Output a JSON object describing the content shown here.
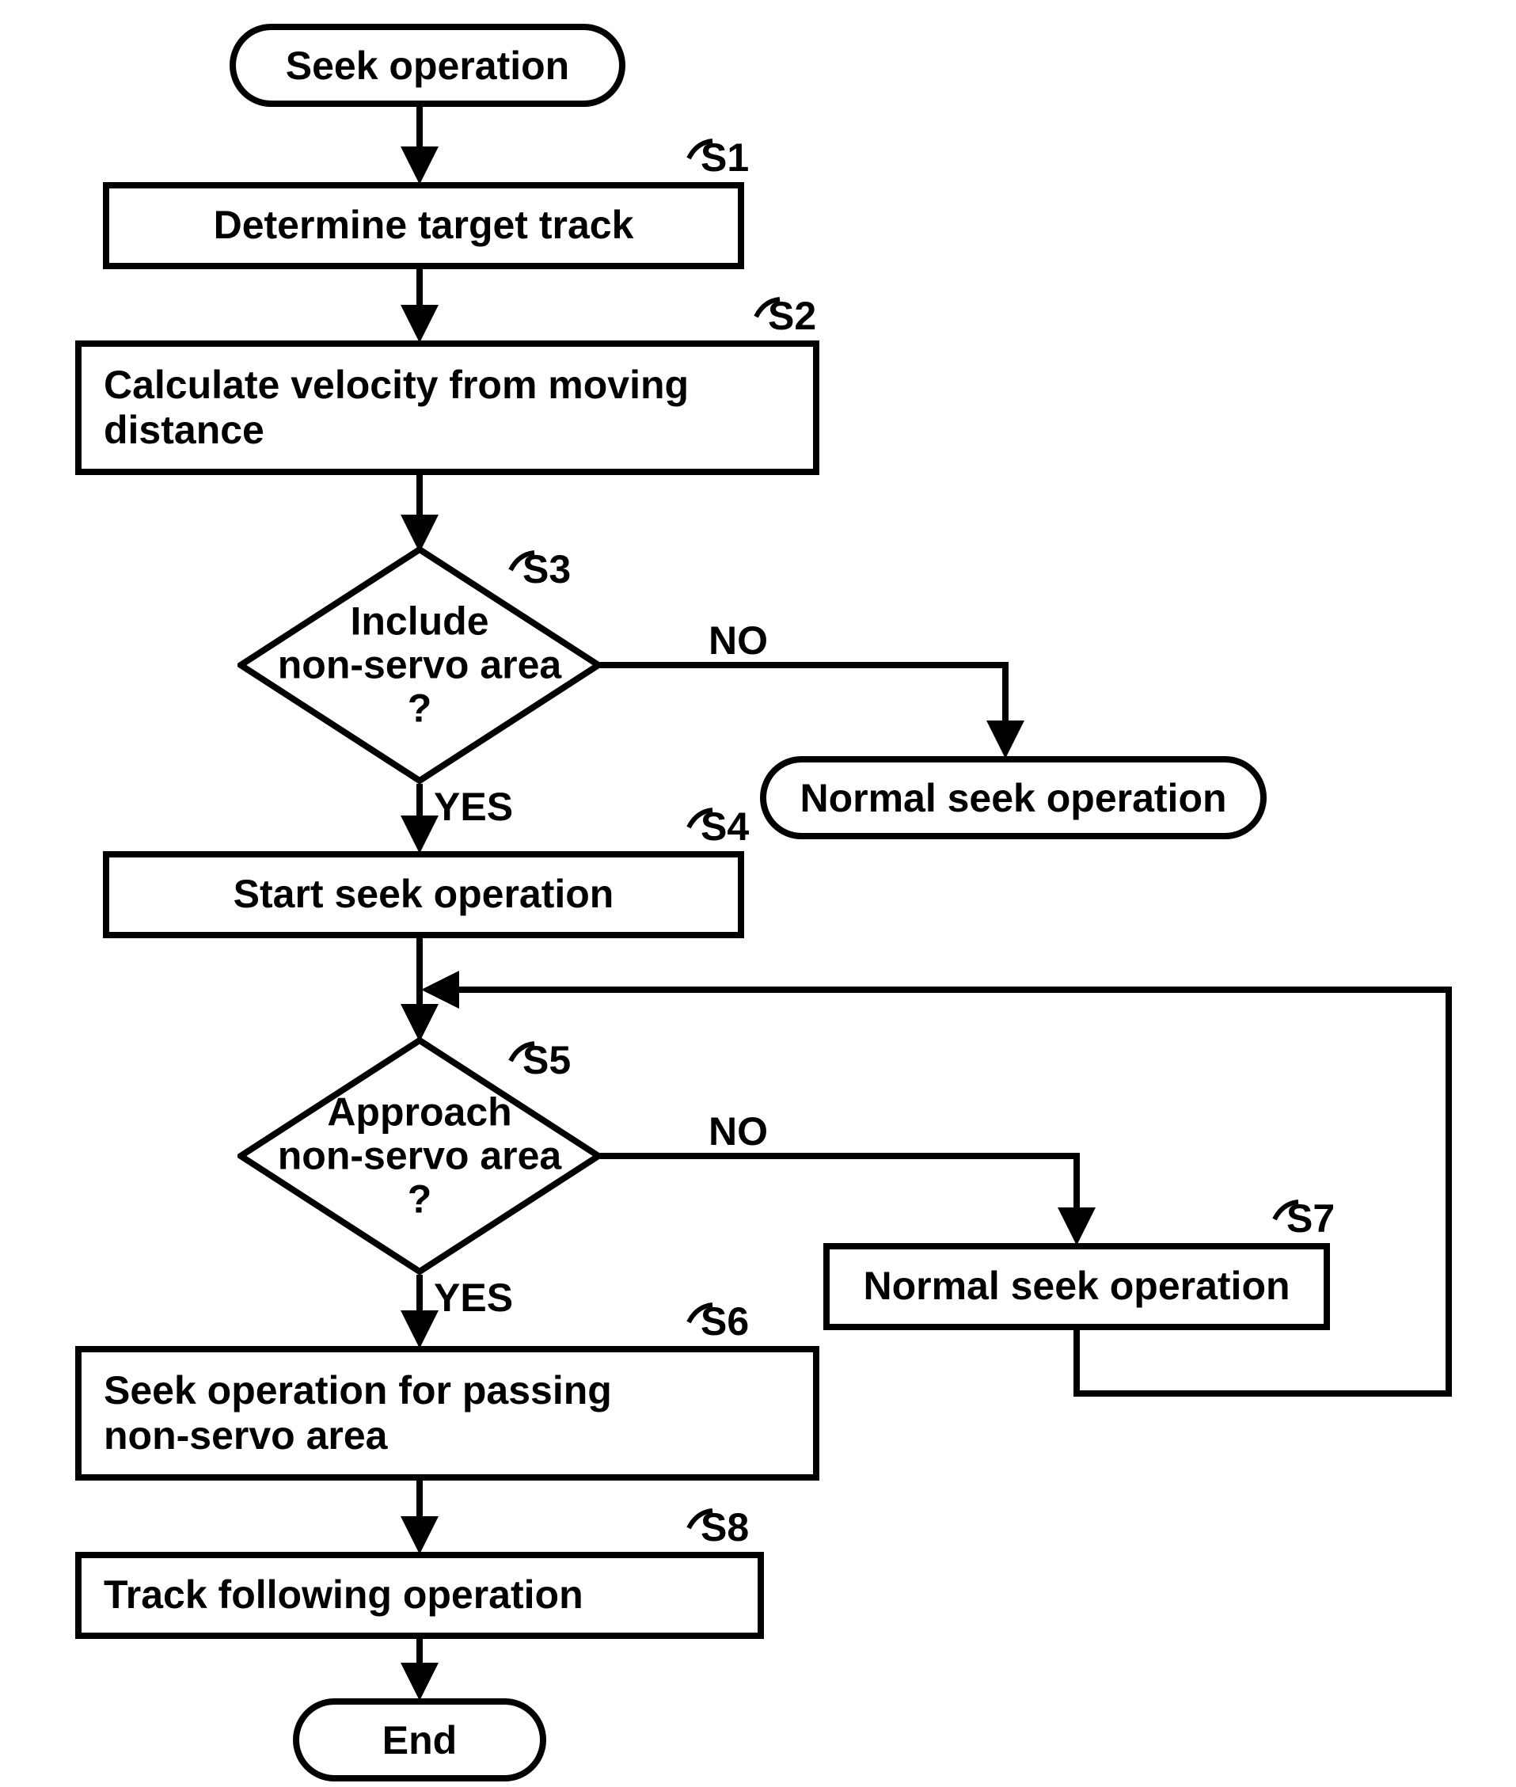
{
  "chart_data": {
    "type": "flowchart",
    "title": "Seek operation",
    "nodes": [
      {
        "id": "start",
        "kind": "terminator",
        "text": "Seek operation"
      },
      {
        "id": "S1",
        "kind": "process",
        "label": "S1",
        "text": "Determine target track"
      },
      {
        "id": "S2",
        "kind": "process",
        "label": "S2",
        "text": "Calculate velocity from moving distance"
      },
      {
        "id": "S3",
        "kind": "decision",
        "label": "S3",
        "text": "Include non-servo area ?",
        "yes": "S4",
        "no": "normal_seek_terminator"
      },
      {
        "id": "normal_seek_terminator",
        "kind": "terminator",
        "text": "Normal seek operation"
      },
      {
        "id": "S4",
        "kind": "process",
        "label": "S4",
        "text": "Start seek operation"
      },
      {
        "id": "S5",
        "kind": "decision",
        "label": "S5",
        "text": "Approach non-servo area ?",
        "yes": "S6",
        "no": "S7"
      },
      {
        "id": "S7",
        "kind": "process",
        "label": "S7",
        "text": "Normal seek operation",
        "loop_back_to": "S5_incoming"
      },
      {
        "id": "S6",
        "kind": "process",
        "label": "S6",
        "text": "Seek operation for passing non-servo area"
      },
      {
        "id": "S8",
        "kind": "process",
        "label": "S8",
        "text": "Track following operation"
      },
      {
        "id": "end",
        "kind": "terminator",
        "text": "End"
      }
    ],
    "edges": [
      {
        "from": "start",
        "to": "S1"
      },
      {
        "from": "S1",
        "to": "S2"
      },
      {
        "from": "S2",
        "to": "S3"
      },
      {
        "from": "S3",
        "to": "S4",
        "label": "YES"
      },
      {
        "from": "S3",
        "to": "normal_seek_terminator",
        "label": "NO"
      },
      {
        "from": "S4",
        "to": "S5"
      },
      {
        "from": "S5",
        "to": "S6",
        "label": "YES"
      },
      {
        "from": "S5",
        "to": "S7",
        "label": "NO"
      },
      {
        "from": "S7",
        "to": "S5",
        "note": "loop back above S5"
      },
      {
        "from": "S6",
        "to": "S8"
      },
      {
        "from": "S8",
        "to": "end"
      }
    ]
  },
  "labels": {
    "yes": "YES",
    "no": "NO",
    "s1": "S1",
    "s2": "S2",
    "s3": "S3",
    "s4": "S4",
    "s5": "S5",
    "s6": "S6",
    "s7": "S7",
    "s8": "S8"
  },
  "text": {
    "start": "Seek operation",
    "s1": "Determine target track",
    "s2": "Calculate velocity from moving\ndistance",
    "s3": "Include\nnon-servo area\n?",
    "normal_term": "Normal seek operation",
    "s4": "Start seek operation",
    "s5": "Approach\nnon-servo area\n?",
    "s7": "Normal seek operation",
    "s6": "Seek operation for passing\nnon-servo area",
    "s8": "Track following operation",
    "end": "End"
  }
}
